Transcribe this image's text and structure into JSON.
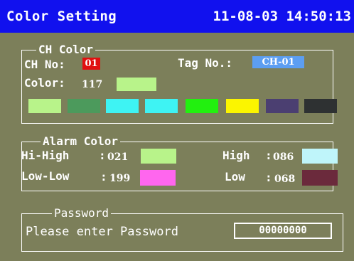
{
  "header": {
    "title": "Color Setting",
    "datetime": "11-08-03 14:50:13",
    "bg": "#1111ee"
  },
  "ch_color": {
    "legend": "CH Color",
    "ch_no_label": "CH No:",
    "ch_no_value": "01",
    "tag_label": "Tag No.:",
    "tag_value": "CH-01",
    "color_label": "Color:",
    "color_value": "117",
    "current_color": "#b8f38a",
    "palette": [
      "#b8f38a",
      "#4c9a5c",
      "#3ef3f3",
      "#3ef3f3",
      "#22f00f",
      "#fbf500",
      "#4b3f71",
      "#2e3132"
    ]
  },
  "alarm_color": {
    "legend": "Alarm Color",
    "hi_high_label": "Hi-High",
    "hi_high_value": "021",
    "hi_high_color": "#b8f38a",
    "high_label": "High",
    "high_value": "086",
    "high_color": "#bff5fa",
    "low_low_label": "Low-Low",
    "low_low_value": "199",
    "low_low_color": "#ff66ee",
    "low_label": "Low",
    "low_value": "068",
    "low_color": "#6b2a3c",
    "colon": ":"
  },
  "password": {
    "legend": "Password",
    "prompt": "Please enter Password",
    "value": "00000000"
  }
}
